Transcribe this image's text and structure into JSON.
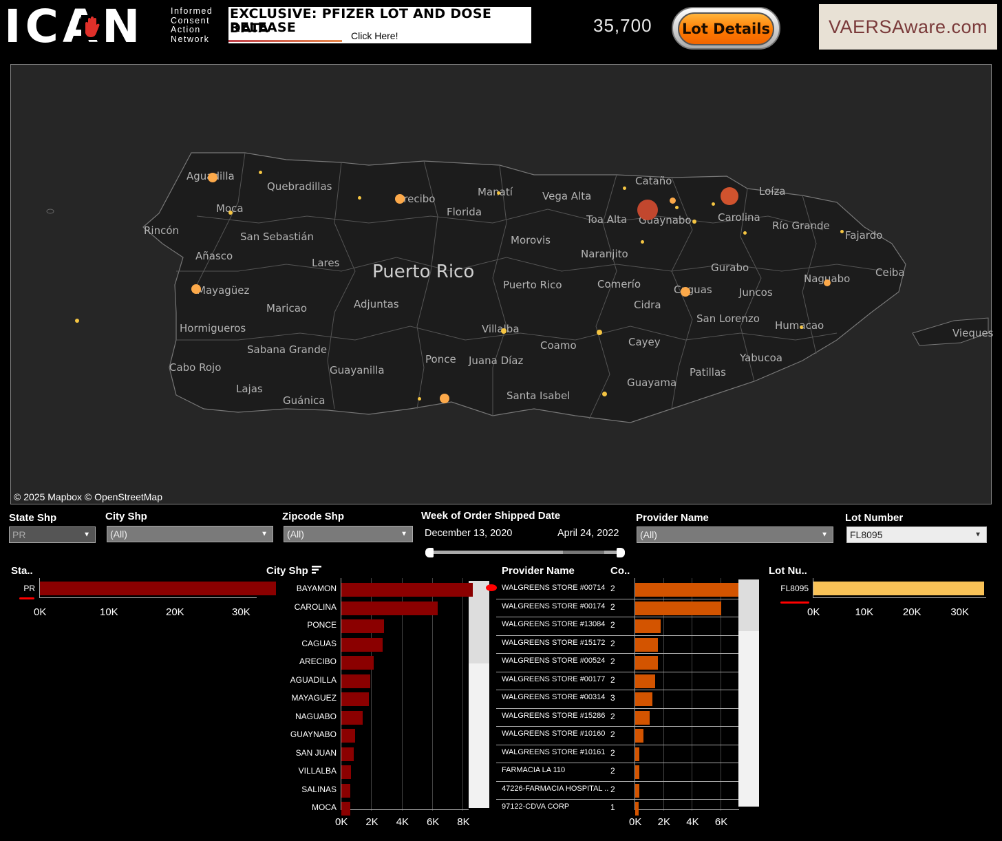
{
  "header": {
    "logo_text": "ICAN",
    "logo_subtitle": [
      "Informed",
      "Consent",
      "Action",
      "Network"
    ],
    "banner_title_line1": "EXCLUSIVE: PFIZER LOT AND DOSE DATA",
    "banner_title_line2": "RELEASE",
    "banner_click": "Click Here!",
    "total_count": "35,700",
    "lot_details_button": "Lot Details",
    "vaersaware_label": "VAERSAware.com"
  },
  "map": {
    "title": "Puerto Rico",
    "attribution": "© 2025 Mapbox  © OpenStreetMap",
    "places": [
      "Aguadilla",
      "Quebradillas",
      "Arecibo",
      "Manatí",
      "Vega Alta",
      "Cataño",
      "Loíza",
      "Moca",
      "Florida",
      "Toa Alta",
      "Guaynabo",
      "Carolina",
      "Río Grande",
      "Fajardo",
      "Rincón",
      "San Sebastián",
      "Morovis",
      "Naranjito",
      "Añasco",
      "Lares",
      "Puerto Rico",
      "Comerío",
      "Gurabo",
      "Naguabo",
      "Ceiba",
      "Mayagüez",
      "Adjuntas",
      "Cidra",
      "Caguas",
      "Juncos",
      "Maricao",
      "San Lorenzo",
      "Hormigueros",
      "Villalba",
      "Coamo",
      "Humacao",
      "Vieques",
      "Sabana Grande",
      "Cayey",
      "Ponce",
      "Juana Díaz",
      "Yabucoa",
      "Cabo Rojo",
      "Guayanilla",
      "Patillas",
      "Guayama",
      "Lajas",
      "Guánica",
      "Santa Isabel"
    ],
    "colors": {
      "small_dot": "#f5c542",
      "medium_dot": "#fca94a",
      "large_dot": "#c2472e"
    }
  },
  "filters": {
    "state": {
      "label": "State Shp",
      "value": "PR"
    },
    "city": {
      "label": "City Shp",
      "value": "(All)"
    },
    "zipcode": {
      "label": "Zipcode Shp",
      "value": "(All)"
    },
    "week": {
      "label": "Week of Order Shipped Date",
      "start": "December 13, 2020",
      "end": "April 24, 2022"
    },
    "provider": {
      "label": "Provider Name",
      "value": "(All)"
    },
    "lot": {
      "label": "Lot Number",
      "value": "FL8095"
    }
  },
  "charts": {
    "state": {
      "title": "Sta..",
      "color": "#8b0000",
      "ticks": [
        "0K",
        "10K",
        "20K",
        "30K"
      ]
    },
    "city": {
      "title": "City Shp",
      "color": "#8b0000",
      "ticks": [
        "0K",
        "2K",
        "4K",
        "6K",
        "8K"
      ]
    },
    "provider": {
      "title_name": "Provider Name",
      "title_count": "Co..",
      "color": "#d35400",
      "ticks": [
        "0K",
        "2K",
        "4K",
        "6K"
      ]
    },
    "lot": {
      "title": "Lot Nu..",
      "color": "#f9c257",
      "ticks": [
        "0K",
        "10K",
        "20K",
        "30K"
      ]
    }
  },
  "chart_data": [
    {
      "type": "bar",
      "title": "Sta..",
      "categories": [
        "PR"
      ],
      "values": [
        35700
      ],
      "xlim": [
        0,
        36000
      ]
    },
    {
      "type": "bar",
      "title": "City Shp",
      "categories": [
        "BAYAMON",
        "CAROLINA",
        "PONCE",
        "CAGUAS",
        "ARECIBO",
        "AGUADILLA",
        "MAYAGUEZ",
        "NAGUABO",
        "GUAYNABO",
        "SAN JUAN",
        "VILLALBA",
        "SALINAS",
        "MOCA"
      ],
      "values": [
        8600,
        6300,
        2800,
        2700,
        2100,
        1900,
        1800,
        1400,
        900,
        800,
        650,
        600,
        600
      ],
      "xlim": [
        0,
        8800
      ]
    },
    {
      "type": "bar",
      "title": "Provider Name",
      "categories": [
        "WALGREENS STORE #00714",
        "WALGREENS STORE #00174",
        "WALGREENS STORE #13084",
        "WALGREENS STORE #15172",
        "WALGREENS STORE #00524",
        "WALGREENS STORE #00177",
        "WALGREENS STORE #00314",
        "WALGREENS STORE #15286",
        "WALGREENS STORE #10160",
        "WALGREENS STORE #10161",
        "FARMACIA LA 110",
        "47226-FARMACIA HOSPITAL ..",
        "97122-CDVA CORP"
      ],
      "counts": [
        "2",
        "2",
        "2",
        "2",
        "2",
        "2",
        "3",
        "2",
        "2",
        "2",
        "2",
        "2",
        "1"
      ],
      "values": [
        7200,
        6000,
        1800,
        1600,
        1600,
        1400,
        1200,
        1000,
        600,
        300,
        300,
        300,
        250
      ],
      "xlim": [
        0,
        7300
      ]
    },
    {
      "type": "bar",
      "title": "Lot Nu..",
      "categories": [
        "FL8095"
      ],
      "values": [
        35700
      ],
      "xlim": [
        0,
        36000
      ]
    }
  ]
}
